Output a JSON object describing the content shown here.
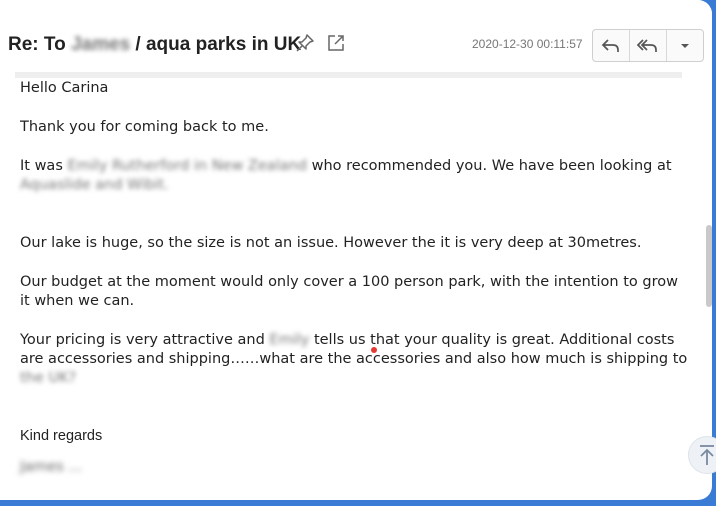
{
  "header": {
    "subject_prefix": "Re: To ",
    "subject_blurred": "James",
    "subject_suffix": " / aqua parks in UK",
    "date": "2020-12-30 00:11:57"
  },
  "icons": {
    "pin": "pin-icon",
    "open": "open-external-icon",
    "reply": "reply-icon",
    "reply_all": "reply-all-icon",
    "more": "chevron-down-icon",
    "back_to_top": "arrow-up-icon"
  },
  "message": {
    "greeting": "Hello Carina",
    "p1": "Thank you for coming back to me.",
    "p2_a": "It was ",
    "p2_blur1": "Emily Rutherford in New Zealand",
    "p2_b": " who recommended you. We have been looking at ",
    "p2_blur2": "Aquaslide and Wibit.",
    "p3": "Our lake is huge, so the size is not an issue. However the it is very deep at 30metres.",
    "p4": "Our budget at the moment would only cover a 100 person park, with the intention to grow it when we can.",
    "p5_a": "Your pricing is very attractive and ",
    "p5_blur1": "Emily",
    "p5_b": " tells us that your quality is great. Additional costs are accessories and shipping……what are the accessories and also how much is shipping to ",
    "p5_blur2": "the UK?",
    "closing": "Kind regards",
    "signature": "James ..."
  }
}
